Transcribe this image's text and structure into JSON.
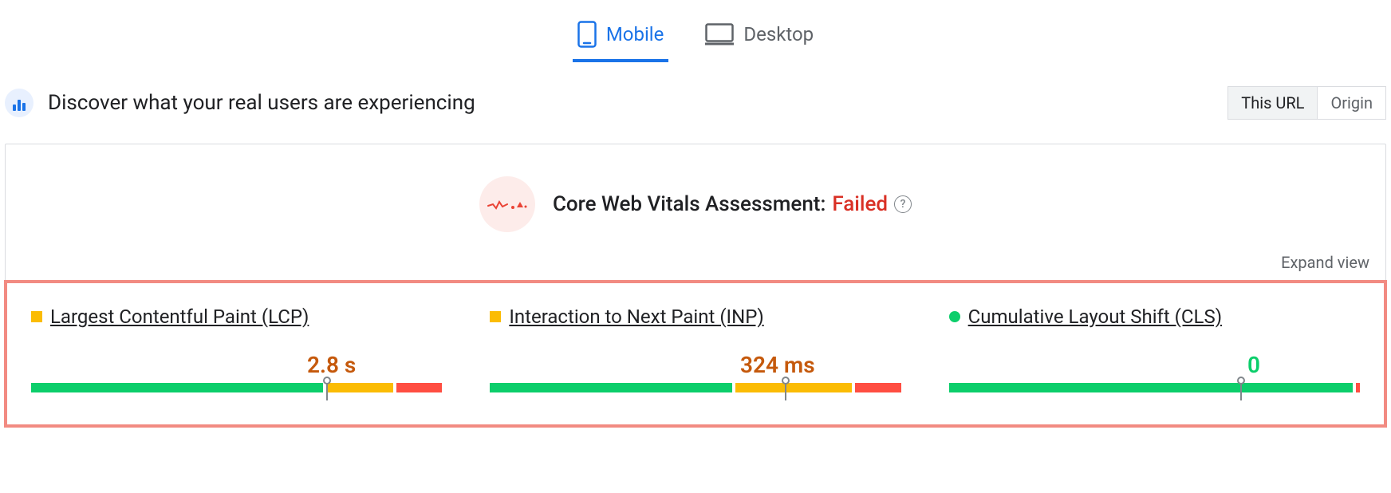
{
  "tabs": {
    "mobile": "Mobile",
    "desktop": "Desktop"
  },
  "header": {
    "title": "Discover what your real users are experiencing",
    "scope": {
      "this_url": "This URL",
      "origin": "Origin"
    }
  },
  "assessment": {
    "label": "Core Web Vitals Assessment:",
    "status": "Failed",
    "help": "?"
  },
  "expand": "Expand view",
  "metrics": {
    "lcp": {
      "name": "Largest Contentful Paint (LCP)",
      "value": "2.8 s",
      "status": "needs-improvement",
      "segments": {
        "green": 70,
        "orange": 16,
        "red": 11
      },
      "marker_pct": 72
    },
    "inp": {
      "name": "Interaction to Next Paint (INP)",
      "value": "324 ms",
      "status": "needs-improvement",
      "segments": {
        "green": 58,
        "orange": 28,
        "red": 11
      },
      "marker_pct": 72
    },
    "cls": {
      "name": "Cumulative Layout Shift (CLS)",
      "value": "0",
      "status": "good",
      "segments": {
        "green": 97,
        "orange": 0,
        "red": 1
      },
      "marker_pct": 71
    }
  }
}
